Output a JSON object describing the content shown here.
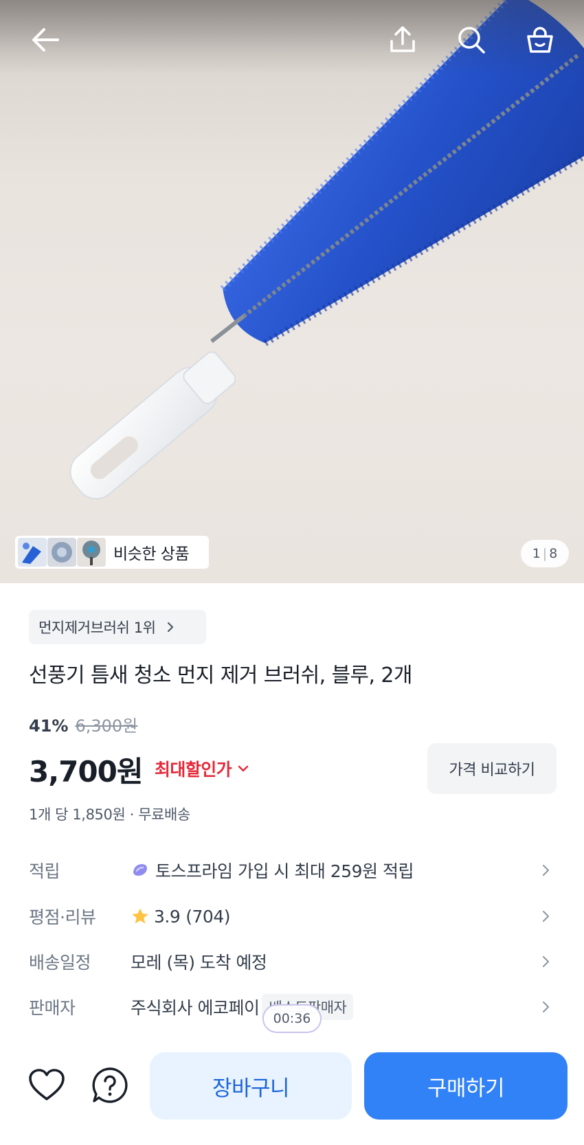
{
  "gallery": {
    "image_alt": "product-photo-blue-fan-cleaning-brush",
    "similar_label": "비슷한 상품",
    "current_page": "1",
    "total_pages": "8"
  },
  "product": {
    "rank_badge": "먼지제거브러쉬 1위",
    "title": "선풍기 틈새 청소 먼지 제거 브러쉬, 블루, 2개",
    "discount_rate": "41%",
    "original_price": "6,300원",
    "price": "3,700원",
    "best_price_label": "최대할인가",
    "compare_button": "가격 비교하기",
    "unit_price": "1개 당 1,850원 · 무료배송"
  },
  "info": {
    "point_label": "적립",
    "point_value": "토스프라임 가입 시 최대 259원 적립",
    "review_label": "평점·리뷰",
    "rating": "3.9",
    "review_count": "(704)",
    "ship_label": "배송일정",
    "ship_value": "모레 (목) 도착 예정",
    "seller_label": "판매자",
    "seller_value": "주식회사 에코페이",
    "seller_badge": "베스트판매자"
  },
  "overlay": {
    "timer": "00:36"
  },
  "actions": {
    "cart": "장바구니",
    "buy": "구매하기"
  },
  "colors": {
    "primary": "#3182f6",
    "primary_light": "#e8f3ff",
    "discount_red": "#e42939",
    "star": "#ffc342",
    "brush_blue": "#2451c9"
  },
  "icons": [
    "back-arrow-icon",
    "share-icon",
    "search-icon",
    "shopping-bag-icon",
    "chevron-right-icon",
    "toss-prime-icon",
    "star-icon",
    "heart-icon",
    "question-icon",
    "chevron-down-icon"
  ]
}
